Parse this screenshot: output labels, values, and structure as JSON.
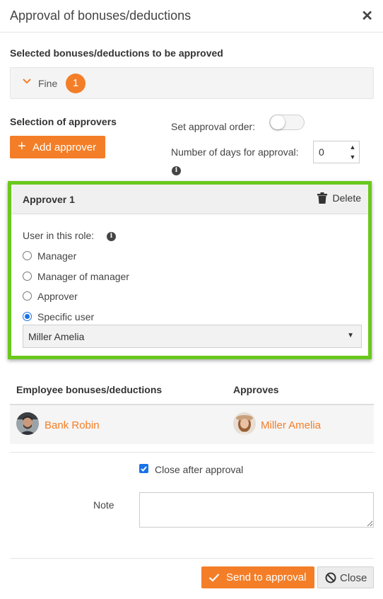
{
  "dialog": {
    "title": "Approval of bonuses/deductions"
  },
  "selected": {
    "heading": "Selected bonuses/deductions to be approved",
    "group_label": "Fine",
    "group_count": "1"
  },
  "approvers_section": {
    "heading": "Selection of approvers",
    "add_label": "Add approver",
    "order_label": "Set approval order:",
    "order_enabled": false,
    "days_label": "Number of days for approval:",
    "days_value": "0"
  },
  "approver_card": {
    "title": "Approver 1",
    "delete_label": "Delete",
    "role_label": "User in this role:",
    "options": [
      {
        "label": "Manager",
        "checked": false
      },
      {
        "label": "Manager of manager",
        "checked": false
      },
      {
        "label": "Approver",
        "checked": false
      },
      {
        "label": "Specific user",
        "checked": true
      }
    ],
    "selected_user": "Miller Amelia"
  },
  "table": {
    "headers": [
      "Employee bonuses/deductions",
      "Approves"
    ],
    "rows": [
      {
        "employee": "Bank Robin",
        "approver": "Miller Amelia"
      }
    ]
  },
  "footer": {
    "close_after_label": "Close after approval",
    "close_after_checked": true,
    "note_label": "Note",
    "note_value": "",
    "send_label": "Send to approval",
    "close_label": "Close"
  },
  "colors": {
    "accent": "#f47e27",
    "highlight_border": "#6ac81e",
    "checked": "#1a73e8"
  }
}
